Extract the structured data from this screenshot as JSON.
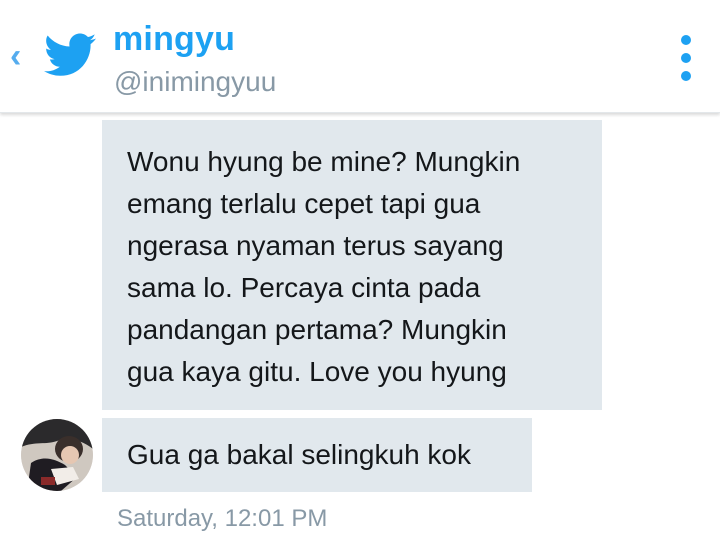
{
  "header": {
    "display_name": "mingyu",
    "handle": "@inimingyuu",
    "back_icon": "chevron-left-icon",
    "logo_icon": "twitter-bird-icon",
    "menu_icon": "more-vertical-icon",
    "accent_color": "#1da1f2"
  },
  "conversation": {
    "messages": [
      {
        "lines": [
          "Wonu hyung be mine? Mungkin",
          "emang terlalu cepet tapi gua",
          "ngerasa nyaman terus sayang",
          "sama lo. Percaya cinta pada",
          "pandangan pertama? Mungkin",
          "gua kaya gitu. Love you hyung"
        ]
      },
      {
        "lines": [
          "Gua ga bakal selingkuh kok"
        ]
      }
    ],
    "timestamp": "Saturday, 12:01 PM",
    "bubble_color": "#e1e8ed"
  }
}
